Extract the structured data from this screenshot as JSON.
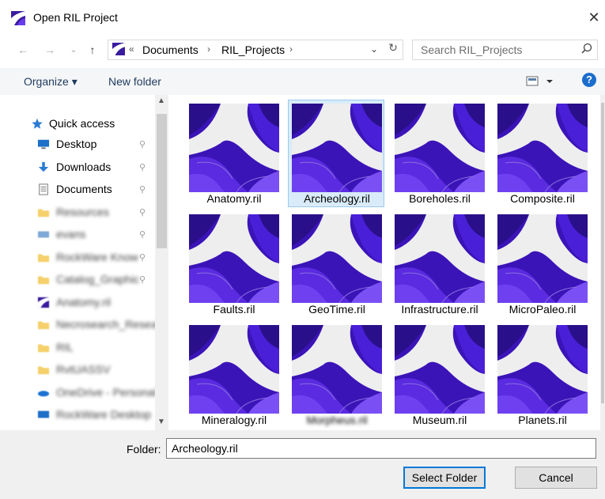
{
  "window": {
    "title": "Open RIL Project",
    "close_glyph": "✕"
  },
  "nav": {
    "back": "←",
    "forward": "→",
    "recent": "⌄",
    "up": "↑",
    "refresh": "↻"
  },
  "address": {
    "overflow": "«",
    "crumbs": [
      "Documents",
      "RIL_Projects"
    ],
    "separator": "›",
    "dropdown": "⌄"
  },
  "search": {
    "placeholder": "Search RIL_Projects",
    "icon": "search-icon"
  },
  "toolbar": {
    "organize": "Organize ▾",
    "new_folder": "New folder",
    "help": "?"
  },
  "sidebar": {
    "quick_access": "Quick access",
    "items": [
      {
        "label": "Desktop",
        "icon": "desktop-icon",
        "pinned": true
      },
      {
        "label": "Downloads",
        "icon": "download-arrow-icon",
        "pinned": true
      },
      {
        "label": "Documents",
        "icon": "document-icon",
        "pinned": true
      },
      {
        "label": "Resources",
        "icon": "folder-icon",
        "pinned": true,
        "blurred": true
      },
      {
        "label": "evans",
        "icon": "network-drive-icon",
        "pinned": true,
        "blurred": true
      },
      {
        "label": "RockWare Know",
        "icon": "folder-icon",
        "pinned": true,
        "blurred": true
      },
      {
        "label": "Catalog_Graphic",
        "icon": "folder-icon",
        "pinned": true,
        "blurred": true
      },
      {
        "label": "Anatomy.ril",
        "icon": "ril-file-icon",
        "pinned": false,
        "blurred": true
      },
      {
        "label": "Necrosearch_Resea",
        "icon": "folder-icon",
        "pinned": false,
        "blurred": true
      },
      {
        "label": "RIL",
        "icon": "folder-icon",
        "pinned": false,
        "blurred": true
      },
      {
        "label": "RvtUASSV",
        "icon": "folder-icon",
        "pinned": false,
        "blurred": true
      },
      {
        "label": "OneDrive - Personal",
        "icon": "cloud-icon",
        "pinned": false,
        "blurred": true
      },
      {
        "label": "RockWare Desktop",
        "icon": "computer-icon",
        "pinned": false,
        "blurred": true
      }
    ],
    "pin_glyph": "📌"
  },
  "files": [
    {
      "name": "Anatomy.ril",
      "selected": false
    },
    {
      "name": "Archeology.ril",
      "selected": true
    },
    {
      "name": "Boreholes.ril",
      "selected": false
    },
    {
      "name": "Composite.ril",
      "selected": false
    },
    {
      "name": "Faults.ril",
      "selected": false
    },
    {
      "name": "GeoTime.ril",
      "selected": false
    },
    {
      "name": "Infrastructure.ril",
      "selected": false
    },
    {
      "name": "MicroPaleo.ril",
      "selected": false
    },
    {
      "name": "Mineralogy.ril",
      "selected": false
    },
    {
      "name": "Morpheus.ril",
      "selected": false,
      "blurred": true
    },
    {
      "name": "Museum.ril",
      "selected": false
    },
    {
      "name": "Planets.ril",
      "selected": false
    }
  ],
  "footer": {
    "folder_label": "Folder:",
    "folder_value": "Archeology.ril",
    "select_button": "Select Folder",
    "cancel_button": "Cancel"
  },
  "colors": {
    "accent": "#0078d7",
    "selection": "#d9ebf9",
    "thumb_purple": "#4b1fd0"
  }
}
